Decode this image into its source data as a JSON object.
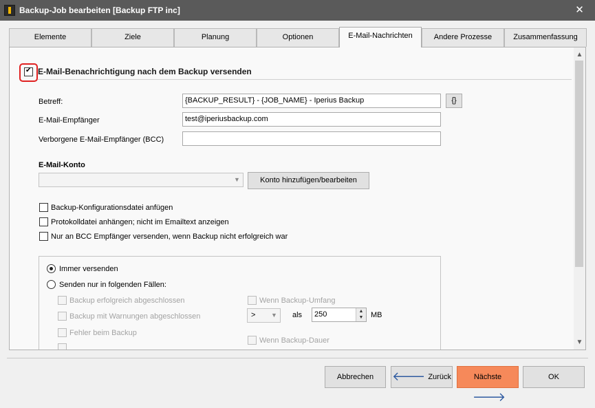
{
  "window": {
    "title": "Backup-Job bearbeiten   [Backup FTP inc]",
    "close_glyph": "✕"
  },
  "tabs": [
    {
      "label": "Elemente"
    },
    {
      "label": "Ziele"
    },
    {
      "label": "Planung"
    },
    {
      "label": "Optionen"
    },
    {
      "label": "E-Mail-Nachrichten"
    },
    {
      "label": "Andere Prozesse"
    },
    {
      "label": "Zusammenfassung"
    }
  ],
  "active_tab": "E-Mail-Nachrichten",
  "section": {
    "enable_label": "E-Mail-Benachrichtigung nach dem Backup versenden",
    "enable_checked": true
  },
  "fields": {
    "subject_label": "Betreff:",
    "subject_value": "{BACKUP_RESULT} - {JOB_NAME} - Iperius Backup",
    "vars_button": "{}",
    "recipient_label": "E-Mail-Empfänger",
    "recipient_value": "test@iperiusbackup.com",
    "bcc_label": "Verborgene E-Mail-Empfänger (BCC)",
    "bcc_value": ""
  },
  "account": {
    "heading": "E-Mail-Konto",
    "selected": "",
    "add_button": "Konto hinzufügen/bearbeiten"
  },
  "options": [
    {
      "label": "Backup-Konfigurationsdatei anfügen",
      "checked": false
    },
    {
      "label": "Protokolldatei anhängen; nicht im Emailtext anzeigen",
      "checked": false
    },
    {
      "label": "Nur an BCC Empfänger versenden, wenn Backup nicht erfolgreich war",
      "checked": false
    }
  ],
  "send_mode": {
    "always_label": "Immer versenden",
    "always_selected": true,
    "only_if_label": "Senden nur in folgenden Fällen:",
    "only_if_selected": false,
    "conditions": [
      {
        "label": "Backup erfolgreich abgeschlossen"
      },
      {
        "label": "Backup mit Warnungen abgeschlossen"
      },
      {
        "label": "Fehler beim Backup"
      }
    ],
    "size_condition_label": "Wenn Backup-Umfang",
    "size_operator": ">",
    "size_als_label": "als",
    "size_value": "250",
    "size_unit": "MB",
    "duration_condition_label": "Wenn Backup-Dauer"
  },
  "footer": {
    "cancel": "Abbrechen",
    "back": "Zurück",
    "next": "Nächste",
    "ok": "OK"
  },
  "colors": {
    "titlebar": "#5a5a5a",
    "primary_button": "#f6895a",
    "highlight_ring": "#e02020",
    "arrow": "#2e5aa0"
  },
  "icons": {
    "app": "app-logo-icon",
    "close": "close-icon",
    "back": "arrow-left-icon",
    "next": "arrow-right-icon"
  }
}
